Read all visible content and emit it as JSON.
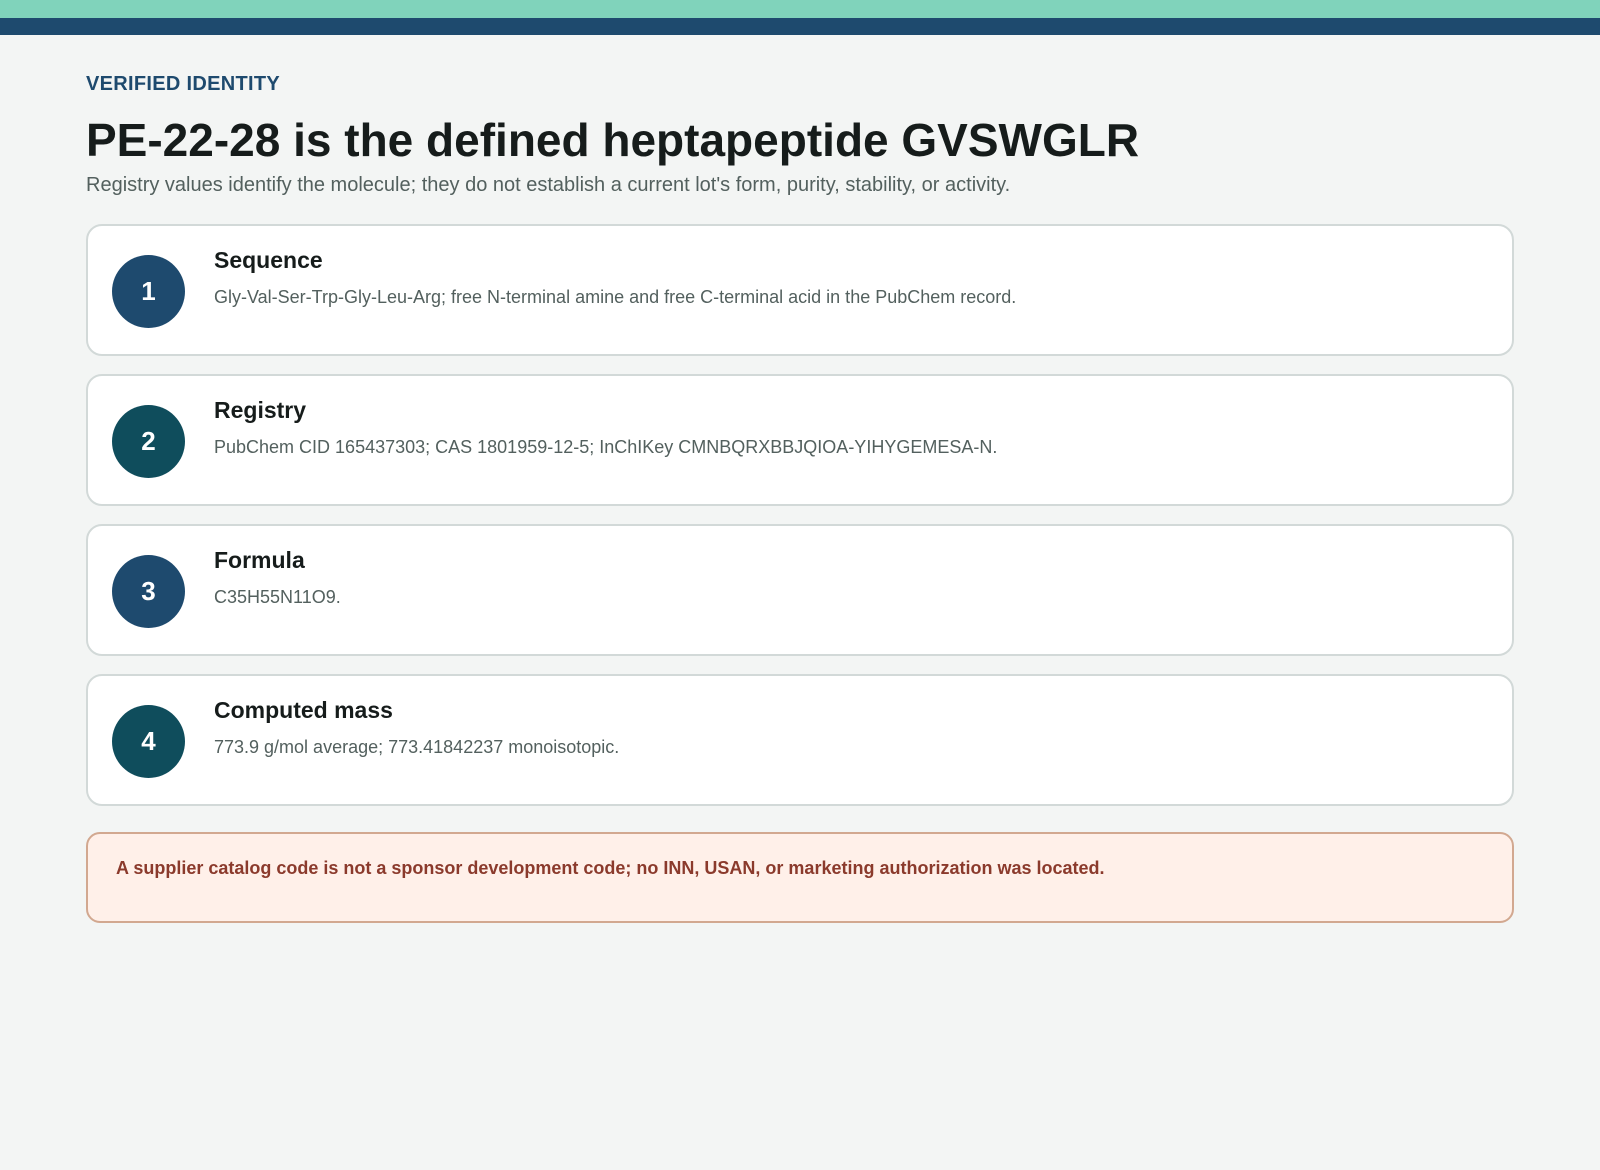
{
  "header": {
    "eyebrow": "VERIFIED IDENTITY",
    "title": "PE-22-28 is the defined heptapeptide GVSWGLR",
    "subtitle": "Registry values identify the molecule; they do not establish a current lot's form, purity, stability, or activity."
  },
  "colors": {
    "band_top": "#80d3bb",
    "band_bottom": "#1e4a6e",
    "badge_blue": "#1e4a6e",
    "badge_teal": "#0f4d5c"
  },
  "cards": [
    {
      "number": "1",
      "title": "Sequence",
      "text": "Gly-Val-Ser-Trp-Gly-Leu-Arg; free N-terminal amine and free C-terminal acid in the PubChem record."
    },
    {
      "number": "2",
      "title": "Registry",
      "text": "PubChem CID 165437303; CAS 1801959-12-5; InChIKey CMNBQRXBBJQIOA-YIHYGEMESA-N."
    },
    {
      "number": "3",
      "title": "Formula",
      "text": "C35H55N11O9."
    },
    {
      "number": "4",
      "title": "Computed mass",
      "text": "773.9 g/mol average; 773.41842237 monoisotopic."
    }
  ],
  "warning": {
    "text": "A supplier catalog code is not a sponsor development code; no INN, USAN, or marketing authorization was located."
  }
}
